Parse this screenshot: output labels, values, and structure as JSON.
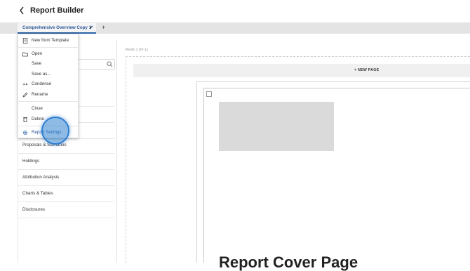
{
  "header": {
    "back_icon": "chevron-left-icon",
    "title": "Report Builder"
  },
  "tabs": {
    "active_label": "Comprehensive Overview Copy 1*",
    "add_label": "+"
  },
  "menu": {
    "items": [
      {
        "label": "New from Template",
        "icon": "document-icon"
      },
      {
        "label": "Open",
        "icon": "folder-icon"
      },
      {
        "label": "Save",
        "icon": ""
      },
      {
        "label": "Save as...",
        "icon": ""
      },
      {
        "label": "Condense",
        "icon": "condense-icon"
      },
      {
        "label": "Rename",
        "icon": "pencil-icon"
      },
      {
        "label": "Close",
        "icon": ""
      },
      {
        "label": "Delete",
        "icon": "trash-icon"
      },
      {
        "label": "Report Settings",
        "icon": "gear-icon"
      }
    ]
  },
  "sidebar": {
    "search_icon": "search-icon",
    "items": [
      {
        "label": "Proposals & Scenarios"
      },
      {
        "label": "Holdings"
      },
      {
        "label": "Attribution Analysis"
      },
      {
        "label": "Charts & Tables"
      },
      {
        "label": "Disclosures"
      }
    ]
  },
  "canvas": {
    "page_indicator": "PAGE 1 OF 11",
    "new_page_label": "+ NEW PAGE",
    "cover_title": "Report Cover Page"
  },
  "colors": {
    "accent": "#2a62a8",
    "tab_text": "#2a5596",
    "click_indicator": "#3084d2"
  }
}
